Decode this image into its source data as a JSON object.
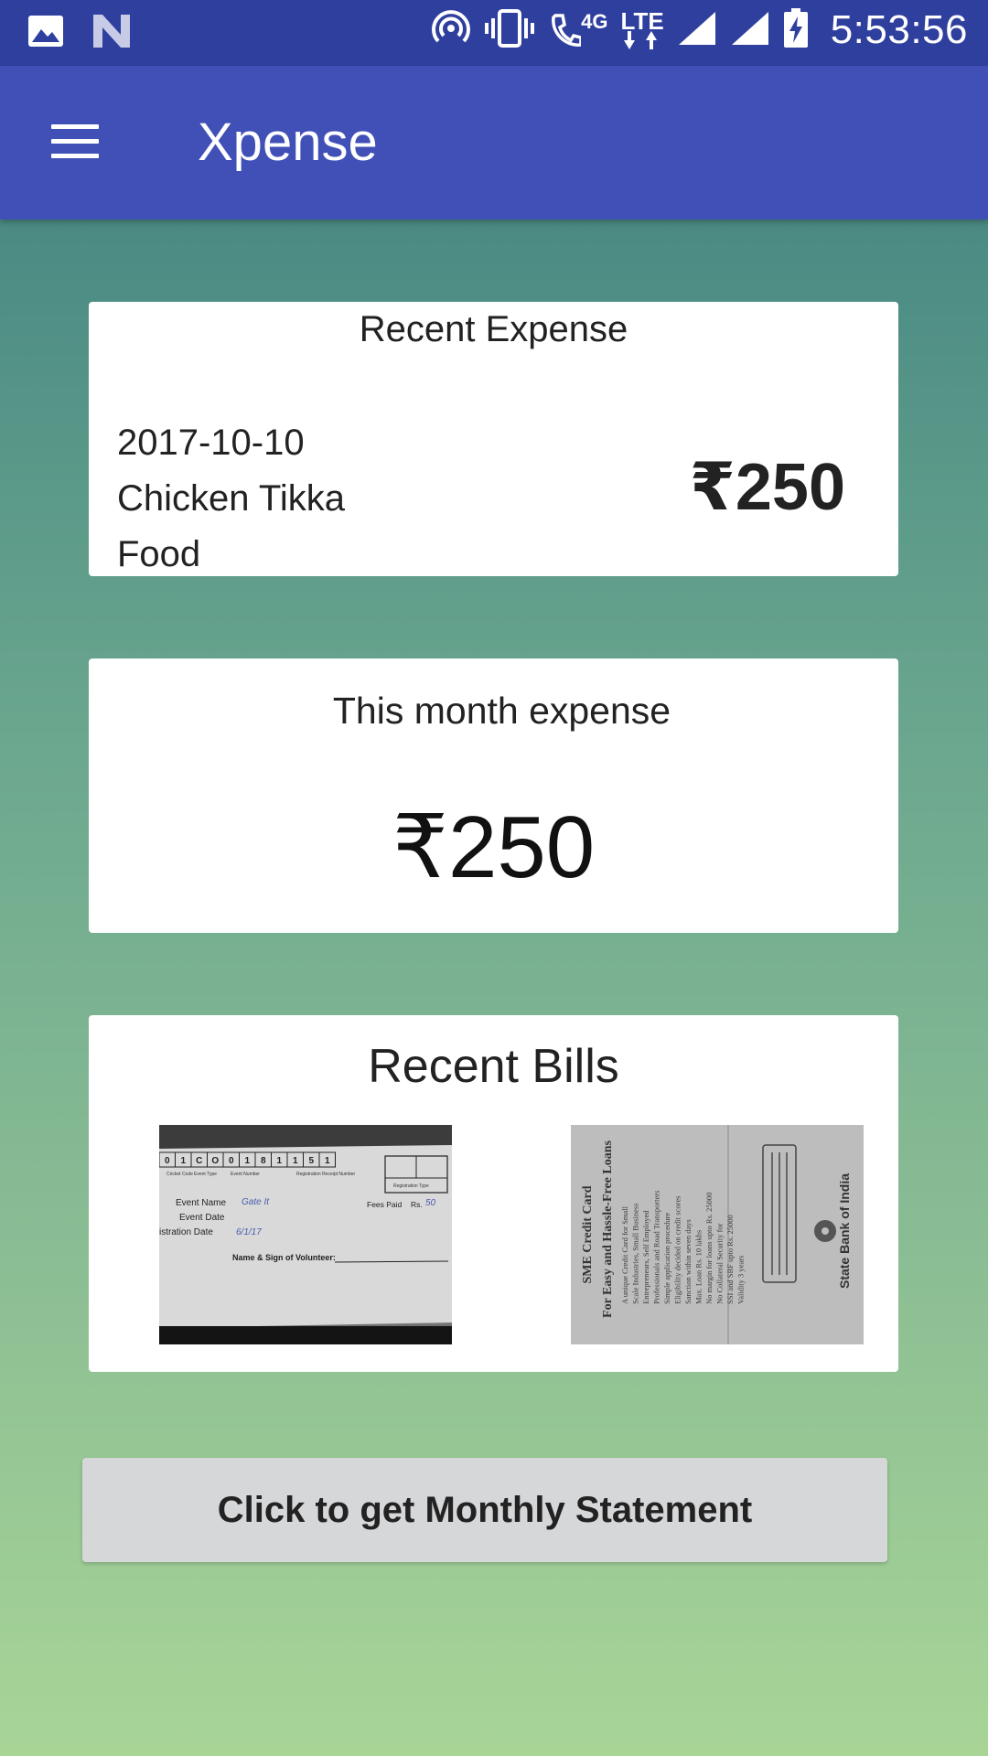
{
  "status_bar": {
    "time": "5:53:56",
    "network": "4G",
    "lte": "LTE",
    "icons": [
      "image-icon",
      "n-icon",
      "hotspot-icon",
      "vibrate-icon",
      "volte-call-icon",
      "signal-icon",
      "signal-icon",
      "battery-charging-icon"
    ]
  },
  "app_bar": {
    "title": "Xpense",
    "menu_icon": "hamburger-menu-icon"
  },
  "recent_expense": {
    "title": "Recent Expense",
    "date": "2017-10-10",
    "item": "Chicken Tikka",
    "category": "Food",
    "amount": "₹250"
  },
  "month_expense": {
    "title": "This month expense",
    "amount": "₹250"
  },
  "recent_bills": {
    "title": "Recent Bills",
    "bill1": {
      "digits": [
        "0",
        "1",
        "C",
        "O",
        "0",
        "1",
        "8",
        "1",
        "1",
        "5",
        "1"
      ],
      "col_headers": [
        "Cricket Code",
        "Event Type",
        "Event Number",
        "Registration Receipt Number",
        "Registration Type"
      ],
      "event_name_label": "Event Name",
      "event_name_value": "Gate It",
      "event_date_label": "Event Date",
      "fees_label": "Fees Paid",
      "fees_currency": "Rs.",
      "fees_value": "50",
      "reg_date_label": "istration Date",
      "reg_date_value": "6/1/17",
      "volunteer_label": "Name & Sign of Volunteer:"
    },
    "bill2": {
      "heading": "SME Credit Card",
      "subheading": "For Easy and Hassle-Free Loans",
      "bank": "State Bank of India",
      "lines": [
        "A unique Credit Card for Small",
        "Scale Industries, Small Business",
        "Entrepreneurs, Self Employed",
        "Professionals and Road Transporters",
        "Simple application procedure",
        "Eligibility decided on credit scores",
        "Sanction within seven days",
        "Max. Loan Rs. 10 lakhs",
        "No margin for loans upto Rs. 25000",
        "No Collateral Security for",
        "SSI and SBF upto Rs. 25000",
        "Validity 3 years"
      ]
    }
  },
  "statement_button": {
    "label": "Click to get Monthly Statement"
  },
  "colors": {
    "status_bar": "#2f3f9e",
    "app_bar": "#4050b7",
    "gradient_top": "#4a8a83",
    "gradient_bottom": "#a8d596",
    "button_bg": "#d6d7d9"
  }
}
